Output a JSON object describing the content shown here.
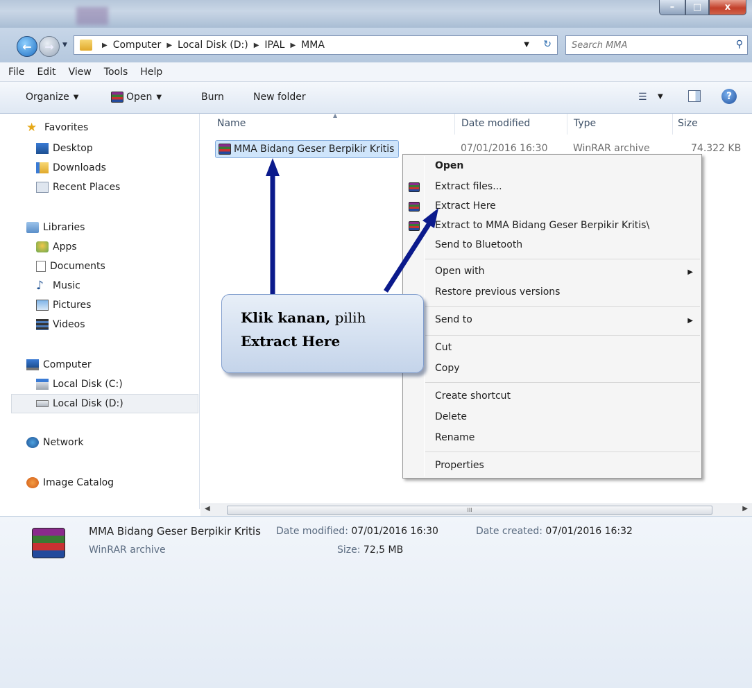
{
  "window": {
    "controls": {
      "minimize": "–",
      "maximize": "□",
      "close": "x"
    }
  },
  "address": {
    "crumbs": [
      "Computer",
      "Local Disk (D:)",
      "IPAL",
      "MMA"
    ],
    "search_placeholder": "Search MMA"
  },
  "menubar": [
    "File",
    "Edit",
    "View",
    "Tools",
    "Help"
  ],
  "toolbar": {
    "organize": "Organize",
    "open": "Open",
    "burn": "Burn",
    "new_folder": "New folder"
  },
  "navpane": {
    "favorites": "Favorites",
    "desktop": "Desktop",
    "downloads": "Downloads",
    "recent_places": "Recent Places",
    "libraries": "Libraries",
    "apps": "Apps",
    "documents": "Documents",
    "music": "Music",
    "pictures": "Pictures",
    "videos": "Videos",
    "computer": "Computer",
    "disk_c": "Local Disk (C:)",
    "disk_d": "Local Disk (D:)",
    "network": "Network",
    "image_catalog": "Image Catalog"
  },
  "columns": {
    "name": "Name",
    "date": "Date modified",
    "type": "Type",
    "size": "Size"
  },
  "file": {
    "name": "MMA Bidang Geser Berpikir Kritis",
    "date": "07/01/2016 16:30",
    "type": "WinRAR archive",
    "size": "74.322 KB"
  },
  "context_menu": {
    "open": "Open",
    "extract_files": "Extract files...",
    "extract_here": "Extract Here",
    "extract_to": "Extract to MMA Bidang Geser Berpikir Kritis\\",
    "send_bluetooth": "Send to Bluetooth",
    "open_with": "Open with",
    "restore": "Restore previous versions",
    "send_to": "Send to",
    "cut": "Cut",
    "copy": "Copy",
    "create_shortcut": "Create shortcut",
    "delete": "Delete",
    "rename": "Rename",
    "properties": "Properties"
  },
  "callout": {
    "line1_bold": "Klik kanan,",
    "line1_rest": " pilih",
    "line2_bold": "Extract Here"
  },
  "details": {
    "name": "MMA Bidang Geser Berpikir Kritis",
    "type": "WinRAR archive",
    "date_modified_label": "Date modified:",
    "date_modified": "07/01/2016 16:30",
    "date_created_label": "Date created:",
    "date_created": "07/01/2016 16:32",
    "size_label": "Size:",
    "size": "72,5 MB"
  },
  "scrollbar": {
    "thumb_grip": "III"
  },
  "colors": {
    "arrow": "#0b1a8c",
    "selection": "#cfe5fb",
    "callout_border": "#7f9ccc"
  }
}
